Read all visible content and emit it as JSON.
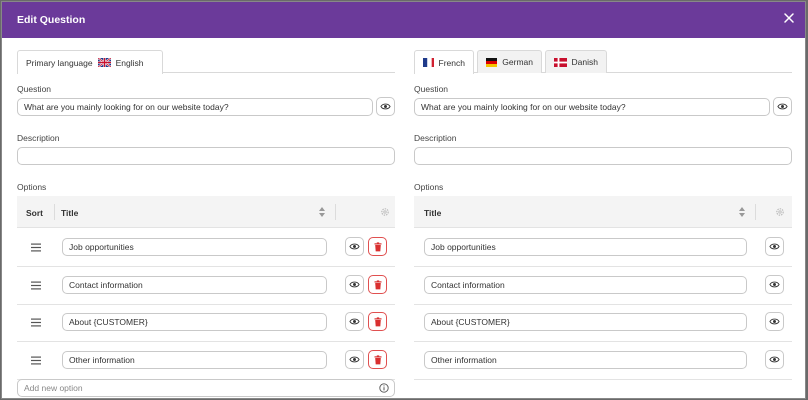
{
  "header": {
    "title": "Edit Question"
  },
  "colors": {
    "header_bg": "#6b3a9a",
    "delete": "#e05050"
  },
  "left": {
    "tab": {
      "label_prefix": "Primary language",
      "label": "English",
      "flag": "uk-flag-icon"
    },
    "question_label": "Question",
    "question_value": "What are you mainly looking for on our website today?",
    "description_label": "Description",
    "description_value": "",
    "options_label": "Options",
    "columns": {
      "sort": "Sort",
      "title": "Title"
    },
    "options": [
      {
        "title": "Job opportunities"
      },
      {
        "title": "Contact information"
      },
      {
        "title": "About {CUSTOMER}"
      },
      {
        "title": "Other information"
      }
    ],
    "add_placeholder": "Add new option"
  },
  "right": {
    "tabs": [
      {
        "label": "French",
        "flag": "france-flag-icon"
      },
      {
        "label": "German",
        "flag": "germany-flag-icon"
      },
      {
        "label": "Danish",
        "flag": "denmark-flag-icon"
      }
    ],
    "question_label": "Question",
    "question_value": "What are you mainly looking for on our website today?",
    "description_label": "Description",
    "description_value": "",
    "options_label": "Options",
    "columns": {
      "title": "Title"
    },
    "options": [
      {
        "title": "Job opportunities"
      },
      {
        "title": "Contact information"
      },
      {
        "title": "About {CUSTOMER}"
      },
      {
        "title": "Other information"
      }
    ]
  }
}
